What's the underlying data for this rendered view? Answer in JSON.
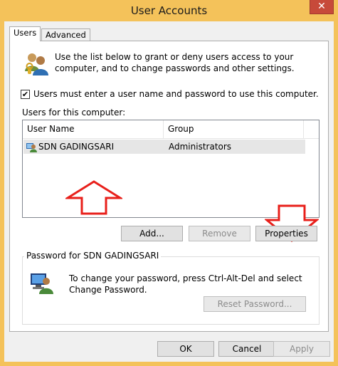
{
  "window": {
    "title": "User Accounts",
    "close_glyph": "✕"
  },
  "tabs": [
    {
      "label": "Users",
      "active": true
    },
    {
      "label": "Advanced",
      "active": false
    }
  ],
  "users_tab": {
    "description": "Use the list below to grant or deny users access to your computer, and to change passwords and other settings.",
    "require_login": {
      "checked": true,
      "check_glyph": "✔",
      "label": "Users must enter a user name and password to use this computer."
    },
    "list_caption": "Users for this computer:",
    "columns": [
      "User Name",
      "Group"
    ],
    "rows": [
      {
        "user_name": "SDN GADINGSARI",
        "group": "Administrators",
        "selected": true
      }
    ],
    "buttons": {
      "add": "Add...",
      "remove": "Remove",
      "properties": "Properties"
    },
    "password_group": {
      "legend": "Password for SDN GADINGSARI",
      "text": "To change your password, press Ctrl-Alt-Del and select Change Password.",
      "reset_button": "Reset Password..."
    }
  },
  "footer": {
    "ok": "OK",
    "cancel": "Cancel",
    "apply": "Apply"
  },
  "colors": {
    "title_bar": "#f4c25a",
    "close_button": "#c74a3a",
    "annotation_arrows": "#e8201b"
  },
  "icons": [
    "users-icon",
    "user-icon",
    "computer-user-icon",
    "up-arrow-annotation",
    "down-arrow-annotation"
  ]
}
